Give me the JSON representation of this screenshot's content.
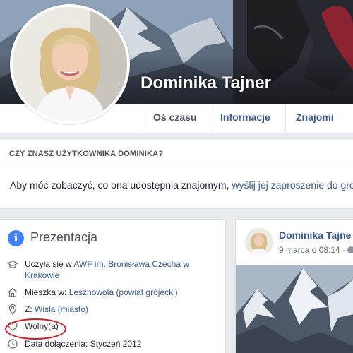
{
  "profile": {
    "name": "Dominika Tajner"
  },
  "tabs": [
    {
      "label": "Oś czasu",
      "active": true
    },
    {
      "label": "Informacje",
      "active": false
    },
    {
      "label": "Znajomi",
      "active": false
    }
  ],
  "know_card": {
    "title": "CZY ZNASZ UŻYTKOWNIKA DOMINIKA?",
    "text": "Aby móc zobaczyć, co ona udostępnia znajomym,",
    "link": "wyślij jej zaproszenie do gro"
  },
  "intro": {
    "title": "Prezentacja",
    "rows": [
      {
        "icon": "graduation-cap-icon",
        "prefix": "Uczyła się w",
        "link": "AWF im. Bronisława Czecha w Krakowie"
      },
      {
        "icon": "home-icon",
        "prefix": "Mieszka w:",
        "link": "Lesznowola (powiat grójecki)"
      },
      {
        "icon": "location-pin-icon",
        "prefix": "Z:",
        "link": "Wisła (miasto)"
      },
      {
        "icon": "heart-icon",
        "prefix": "Wolny(a)",
        "link": ""
      },
      {
        "icon": "clock-icon",
        "prefix": "Data dołączenia: Styczeń 2012",
        "link": ""
      }
    ]
  },
  "post": {
    "author": "Dominika Tajne",
    "date": "9 marca o 08:14 ·"
  },
  "colors": {
    "link": "#365899",
    "tab_link": "#385898",
    "highlight_circle": "#e0141e",
    "page_bg": "#e9ebee"
  }
}
